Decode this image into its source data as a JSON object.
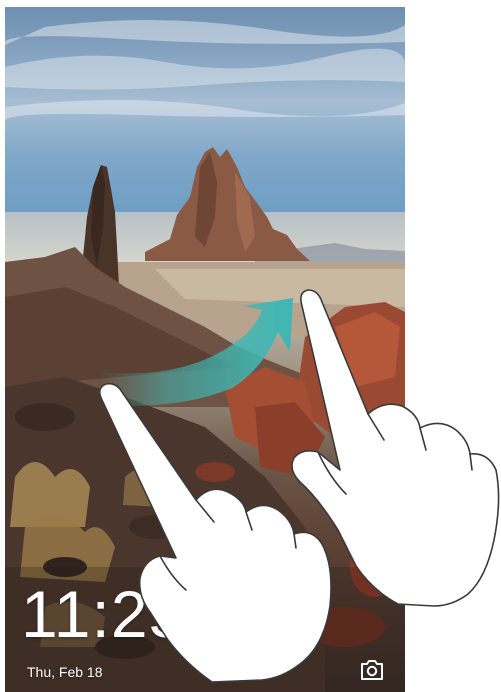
{
  "lockscreen": {
    "time": "11:25",
    "date": "Thu, Feb 18",
    "camera_icon": "camera-icon"
  },
  "gesture": {
    "arrow_icon": "swipe-arrow-icon",
    "start_hand_icon": "hand-pointer-icon",
    "end_hand_icon": "hand-pointer-icon",
    "arrow_color": "#3fb7b4"
  }
}
